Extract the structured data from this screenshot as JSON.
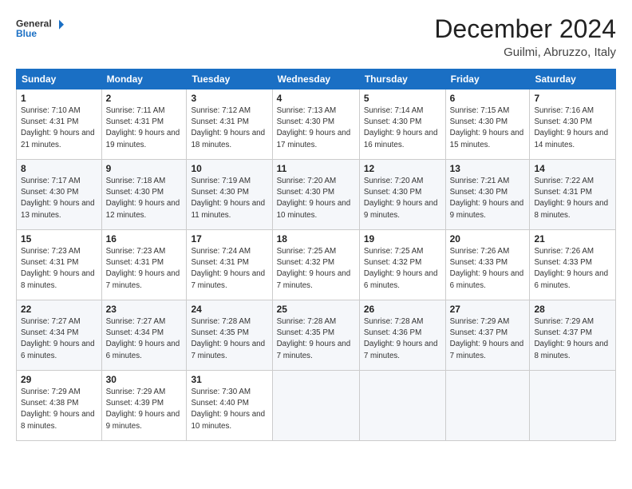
{
  "header": {
    "logo_line1": "General",
    "logo_line2": "Blue",
    "month": "December 2024",
    "location": "Guilmi, Abruzzo, Italy"
  },
  "weekdays": [
    "Sunday",
    "Monday",
    "Tuesday",
    "Wednesday",
    "Thursday",
    "Friday",
    "Saturday"
  ],
  "weeks": [
    [
      {
        "day": 1,
        "sunrise": "7:10 AM",
        "sunset": "4:31 PM",
        "daylight": "9 hours and 21 minutes."
      },
      {
        "day": 2,
        "sunrise": "7:11 AM",
        "sunset": "4:31 PM",
        "daylight": "9 hours and 19 minutes."
      },
      {
        "day": 3,
        "sunrise": "7:12 AM",
        "sunset": "4:31 PM",
        "daylight": "9 hours and 18 minutes."
      },
      {
        "day": 4,
        "sunrise": "7:13 AM",
        "sunset": "4:30 PM",
        "daylight": "9 hours and 17 minutes."
      },
      {
        "day": 5,
        "sunrise": "7:14 AM",
        "sunset": "4:30 PM",
        "daylight": "9 hours and 16 minutes."
      },
      {
        "day": 6,
        "sunrise": "7:15 AM",
        "sunset": "4:30 PM",
        "daylight": "9 hours and 15 minutes."
      },
      {
        "day": 7,
        "sunrise": "7:16 AM",
        "sunset": "4:30 PM",
        "daylight": "9 hours and 14 minutes."
      }
    ],
    [
      {
        "day": 8,
        "sunrise": "7:17 AM",
        "sunset": "4:30 PM",
        "daylight": "9 hours and 13 minutes."
      },
      {
        "day": 9,
        "sunrise": "7:18 AM",
        "sunset": "4:30 PM",
        "daylight": "9 hours and 12 minutes."
      },
      {
        "day": 10,
        "sunrise": "7:19 AM",
        "sunset": "4:30 PM",
        "daylight": "9 hours and 11 minutes."
      },
      {
        "day": 11,
        "sunrise": "7:20 AM",
        "sunset": "4:30 PM",
        "daylight": "9 hours and 10 minutes."
      },
      {
        "day": 12,
        "sunrise": "7:20 AM",
        "sunset": "4:30 PM",
        "daylight": "9 hours and 9 minutes."
      },
      {
        "day": 13,
        "sunrise": "7:21 AM",
        "sunset": "4:30 PM",
        "daylight": "9 hours and 9 minutes."
      },
      {
        "day": 14,
        "sunrise": "7:22 AM",
        "sunset": "4:31 PM",
        "daylight": "9 hours and 8 minutes."
      }
    ],
    [
      {
        "day": 15,
        "sunrise": "7:23 AM",
        "sunset": "4:31 PM",
        "daylight": "9 hours and 8 minutes."
      },
      {
        "day": 16,
        "sunrise": "7:23 AM",
        "sunset": "4:31 PM",
        "daylight": "9 hours and 7 minutes."
      },
      {
        "day": 17,
        "sunrise": "7:24 AM",
        "sunset": "4:31 PM",
        "daylight": "9 hours and 7 minutes."
      },
      {
        "day": 18,
        "sunrise": "7:25 AM",
        "sunset": "4:32 PM",
        "daylight": "9 hours and 7 minutes."
      },
      {
        "day": 19,
        "sunrise": "7:25 AM",
        "sunset": "4:32 PM",
        "daylight": "9 hours and 6 minutes."
      },
      {
        "day": 20,
        "sunrise": "7:26 AM",
        "sunset": "4:33 PM",
        "daylight": "9 hours and 6 minutes."
      },
      {
        "day": 21,
        "sunrise": "7:26 AM",
        "sunset": "4:33 PM",
        "daylight": "9 hours and 6 minutes."
      }
    ],
    [
      {
        "day": 22,
        "sunrise": "7:27 AM",
        "sunset": "4:34 PM",
        "daylight": "9 hours and 6 minutes."
      },
      {
        "day": 23,
        "sunrise": "7:27 AM",
        "sunset": "4:34 PM",
        "daylight": "9 hours and 6 minutes."
      },
      {
        "day": 24,
        "sunrise": "7:28 AM",
        "sunset": "4:35 PM",
        "daylight": "9 hours and 7 minutes."
      },
      {
        "day": 25,
        "sunrise": "7:28 AM",
        "sunset": "4:35 PM",
        "daylight": "9 hours and 7 minutes."
      },
      {
        "day": 26,
        "sunrise": "7:28 AM",
        "sunset": "4:36 PM",
        "daylight": "9 hours and 7 minutes."
      },
      {
        "day": 27,
        "sunrise": "7:29 AM",
        "sunset": "4:37 PM",
        "daylight": "9 hours and 7 minutes."
      },
      {
        "day": 28,
        "sunrise": "7:29 AM",
        "sunset": "4:37 PM",
        "daylight": "9 hours and 8 minutes."
      }
    ],
    [
      {
        "day": 29,
        "sunrise": "7:29 AM",
        "sunset": "4:38 PM",
        "daylight": "9 hours and 8 minutes."
      },
      {
        "day": 30,
        "sunrise": "7:29 AM",
        "sunset": "4:39 PM",
        "daylight": "9 hours and 9 minutes."
      },
      {
        "day": 31,
        "sunrise": "7:30 AM",
        "sunset": "4:40 PM",
        "daylight": "9 hours and 10 minutes."
      },
      null,
      null,
      null,
      null
    ]
  ]
}
